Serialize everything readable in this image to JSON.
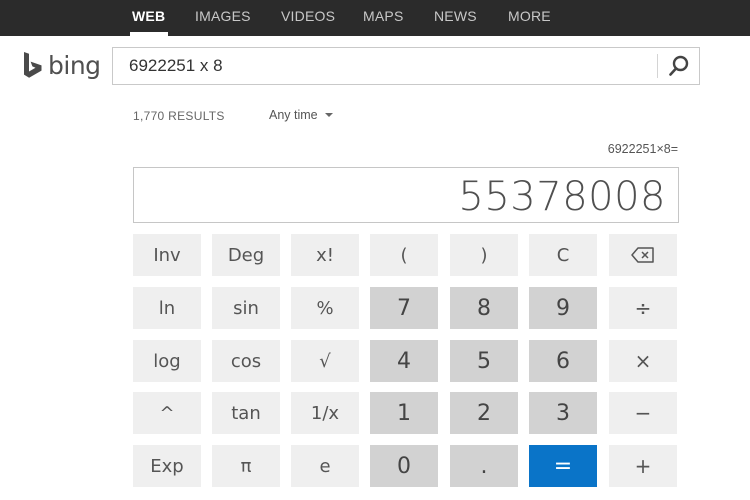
{
  "nav": {
    "items": [
      "WEB",
      "IMAGES",
      "VIDEOS",
      "MAPS",
      "NEWS",
      "MORE"
    ],
    "active": "WEB"
  },
  "logo": {
    "text": "bing",
    "color": "#008373"
  },
  "search": {
    "query": "6922251 x 8"
  },
  "results": {
    "count": "1,770 RESULTS",
    "time_filter": "Any time"
  },
  "calculator": {
    "expression": "6922251×8=",
    "result": "55378008",
    "rows": [
      [
        {
          "label": "Inv",
          "type": "fn"
        },
        {
          "label": "Deg",
          "type": "fn"
        },
        {
          "label": "x!",
          "type": "fn"
        },
        {
          "label": "(",
          "type": "fn"
        },
        {
          "label": ")",
          "type": "fn"
        },
        {
          "label": "C",
          "type": "fn"
        },
        {
          "label": "",
          "type": "backspace",
          "icon": "backspace-icon"
        }
      ],
      [
        {
          "label": "ln",
          "type": "fn"
        },
        {
          "label": "sin",
          "type": "fn"
        },
        {
          "label": "%",
          "type": "fn"
        },
        {
          "label": "7",
          "type": "num"
        },
        {
          "label": "8",
          "type": "num"
        },
        {
          "label": "9",
          "type": "num"
        },
        {
          "label": "÷",
          "type": "op"
        }
      ],
      [
        {
          "label": "log",
          "type": "fn"
        },
        {
          "label": "cos",
          "type": "fn"
        },
        {
          "label": "√",
          "type": "fn"
        },
        {
          "label": "4",
          "type": "num"
        },
        {
          "label": "5",
          "type": "num"
        },
        {
          "label": "6",
          "type": "num"
        },
        {
          "label": "×",
          "type": "op"
        }
      ],
      [
        {
          "label": "^",
          "type": "fn"
        },
        {
          "label": "tan",
          "type": "fn"
        },
        {
          "label": "1/x",
          "type": "fn"
        },
        {
          "label": "1",
          "type": "num"
        },
        {
          "label": "2",
          "type": "num"
        },
        {
          "label": "3",
          "type": "num"
        },
        {
          "label": "−",
          "type": "op"
        }
      ],
      [
        {
          "label": "Exp",
          "type": "fn"
        },
        {
          "label": "π",
          "type": "fn"
        },
        {
          "label": "e",
          "type": "fn"
        },
        {
          "label": "0",
          "type": "num"
        },
        {
          "label": ".",
          "type": "num"
        },
        {
          "label": "=",
          "type": "eq"
        },
        {
          "label": "+",
          "type": "op"
        }
      ]
    ]
  },
  "colors": {
    "nav_bg": "#2b2b2b",
    "accent": "#0a74c8",
    "key_fn": "#efefef",
    "key_num": "#d2d2d2"
  }
}
